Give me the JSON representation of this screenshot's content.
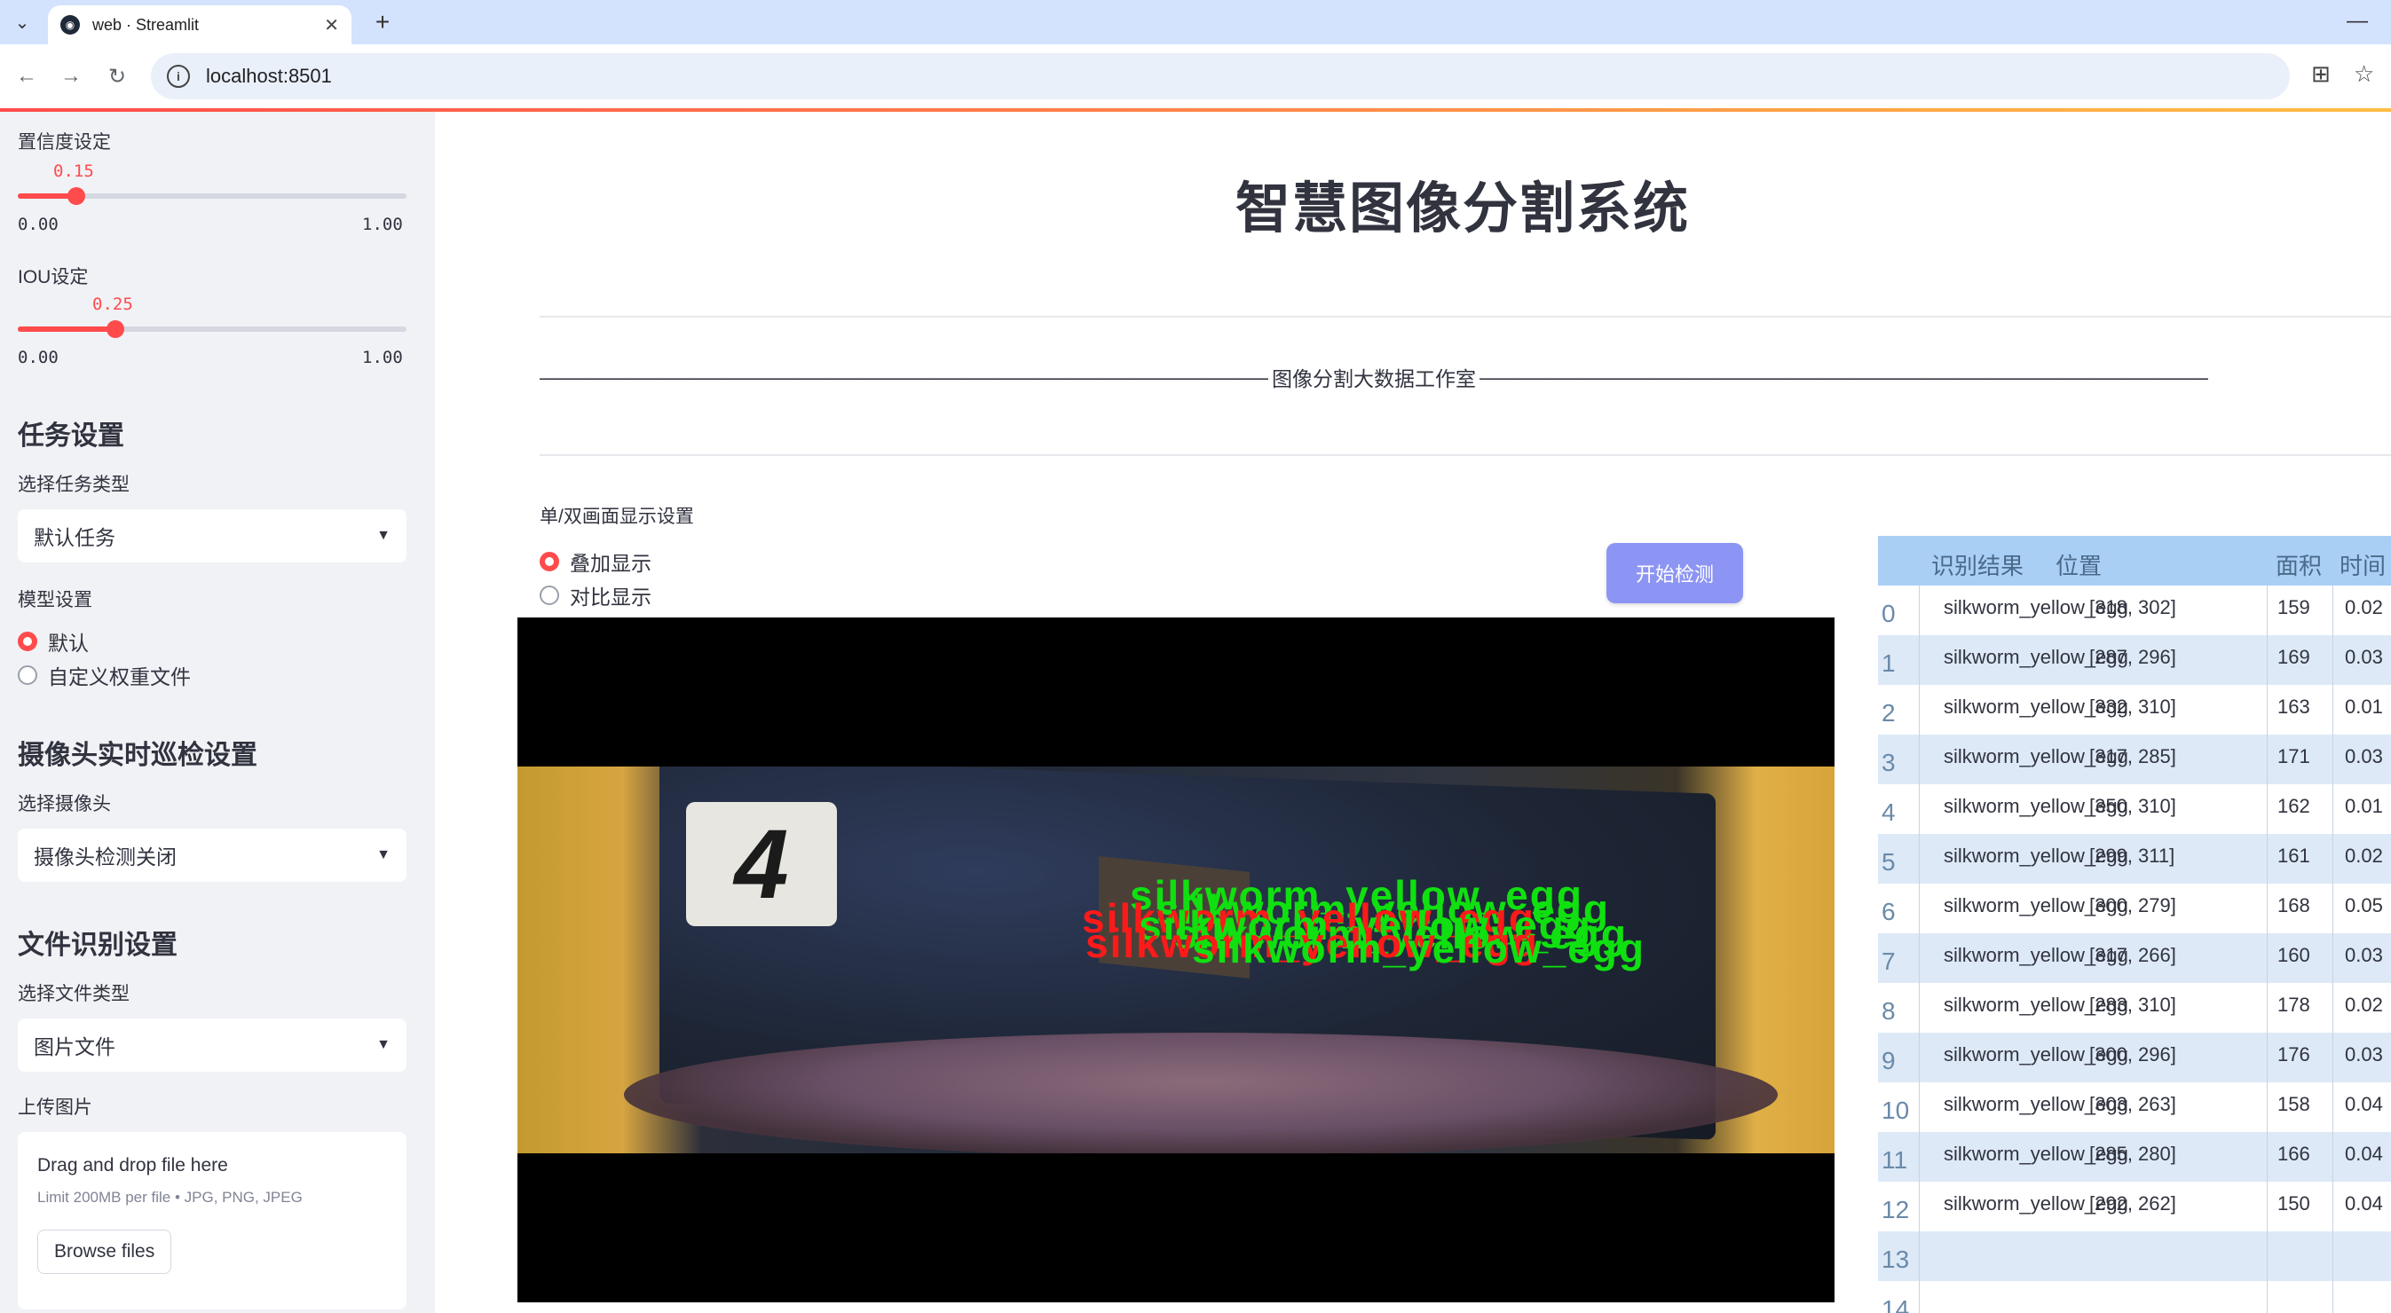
{
  "browser": {
    "tab_title": "web · Streamlit",
    "url": "localhost:8501"
  },
  "sidebar": {
    "confidence": {
      "label": "置信度设定",
      "value": "0.15",
      "min": "0.00",
      "max": "1.00",
      "fraction": 0.15
    },
    "iou": {
      "label": "IOU设定",
      "value": "0.25",
      "min": "0.00",
      "max": "1.00",
      "fraction": 0.25
    },
    "task": {
      "heading": "任务设置",
      "select_label": "选择任务类型",
      "selected": "默认任务"
    },
    "model": {
      "label": "模型设置",
      "options": [
        "默认",
        "自定义权重文件"
      ],
      "selected_index": 0
    },
    "camera": {
      "heading": "摄像头实时巡检设置",
      "select_label": "选择摄像头",
      "selected": "摄像头检测关闭"
    },
    "file": {
      "heading": "文件识别设置",
      "select_label": "选择文件类型",
      "selected": "图片文件"
    },
    "upload": {
      "label": "上传图片",
      "drag_text": "Drag and drop file here",
      "limit_text": "Limit 200MB per file • JPG, PNG, JPEG",
      "browse_label": "Browse files"
    }
  },
  "main": {
    "title": "智慧图像分割系统",
    "studio": "图像分割大数据工作室",
    "display_label": "单/双画面显示设置",
    "display_options": [
      "叠加显示",
      "对比显示"
    ],
    "display_selected_index": 0,
    "start_button": "开始检测",
    "image": {
      "number_tag": "4",
      "detection_text": "silkworm_yellow_egg"
    }
  },
  "table": {
    "headers": [
      "识别结果",
      "位置",
      "面积",
      "时间"
    ],
    "rows": [
      {
        "index": "0",
        "result": "silkworm_yellow_egg",
        "position": "[318, 302]",
        "area": "159",
        "time": "0.02"
      },
      {
        "index": "1",
        "result": "silkworm_yellow_egg",
        "position": "[287, 296]",
        "area": "169",
        "time": "0.03"
      },
      {
        "index": "2",
        "result": "silkworm_yellow_egg",
        "position": "[332, 310]",
        "area": "163",
        "time": "0.01"
      },
      {
        "index": "3",
        "result": "silkworm_yellow_egg",
        "position": "[317, 285]",
        "area": "171",
        "time": "0.03"
      },
      {
        "index": "4",
        "result": "silkworm_yellow_egg",
        "position": "[350, 310]",
        "area": "162",
        "time": "0.01"
      },
      {
        "index": "5",
        "result": "silkworm_yellow_egg",
        "position": "[299, 311]",
        "area": "161",
        "time": "0.02"
      },
      {
        "index": "6",
        "result": "silkworm_yellow_egg",
        "position": "[300, 279]",
        "area": "168",
        "time": "0.05"
      },
      {
        "index": "7",
        "result": "silkworm_yellow_egg",
        "position": "[317, 266]",
        "area": "160",
        "time": "0.03"
      },
      {
        "index": "8",
        "result": "silkworm_yellow_egg",
        "position": "[283, 310]",
        "area": "178",
        "time": "0.02"
      },
      {
        "index": "9",
        "result": "silkworm_yellow_egg",
        "position": "[300, 296]",
        "area": "176",
        "time": "0.03"
      },
      {
        "index": "10",
        "result": "silkworm_yellow_egg",
        "position": "[303, 263]",
        "area": "158",
        "time": "0.04"
      },
      {
        "index": "11",
        "result": "silkworm_yellow_egg",
        "position": "[285, 280]",
        "area": "166",
        "time": "0.04"
      },
      {
        "index": "12",
        "result": "silkworm_yellow_egg",
        "position": "[292, 262]",
        "area": "150",
        "time": "0.04"
      },
      {
        "index": "13",
        "result": "",
        "position": "",
        "area": "",
        "time": ""
      },
      {
        "index": "14",
        "result": "",
        "position": "",
        "area": "",
        "time": ""
      }
    ]
  },
  "colors": {
    "accent": "#ff4b4b",
    "sidebar_bg": "#f0f2f6",
    "button": "#8d95f4",
    "table_header": "#a9cff5",
    "table_alt_row": "#dde9f7",
    "detection_green": "#10e010",
    "detection_red": "#ff1a1a"
  }
}
